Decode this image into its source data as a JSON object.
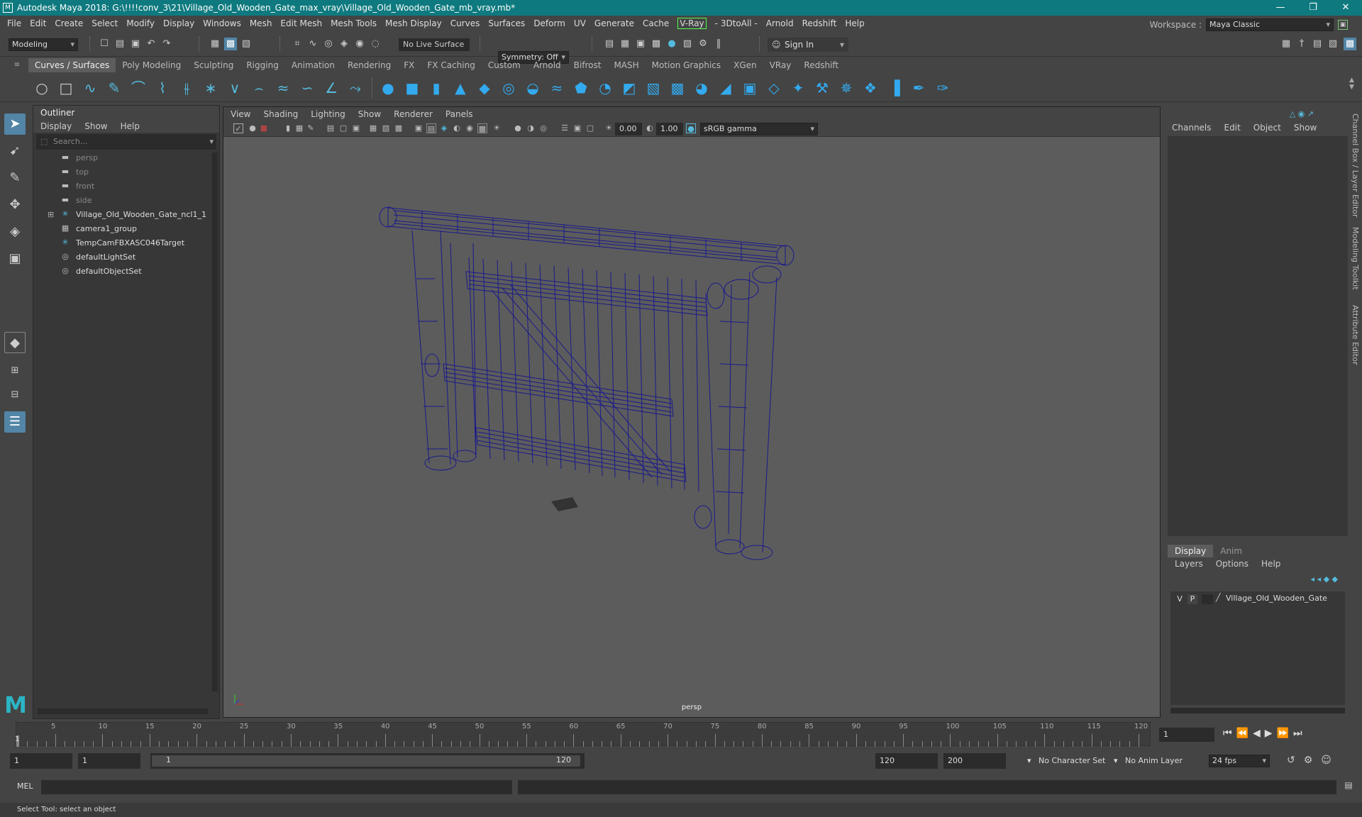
{
  "window": {
    "title": "Autodesk Maya 2018: G:\\!!!!conv_3\\21\\Village_Old_Wooden_Gate_max_vray\\Village_Old_Wooden_Gate_mb_vray.mb*",
    "min": "—",
    "max": "❐",
    "close": "✕"
  },
  "menubar": [
    "File",
    "Edit",
    "Create",
    "Select",
    "Modify",
    "Display",
    "Windows",
    "Mesh",
    "Edit Mesh",
    "Mesh Tools",
    "Mesh Display",
    "Curves",
    "Surfaces",
    "Deform",
    "UV",
    "Generate",
    "Cache",
    "V-Ray",
    "- 3DtoAll -",
    "Arnold",
    "Redshift",
    "Help"
  ],
  "workspace": {
    "label": "Workspace :",
    "value": "Maya Classic"
  },
  "status": {
    "mode": "Modeling",
    "live_surface": "No Live Surface",
    "symmetry": "Symmetry: Off",
    "sign_in": "Sign In"
  },
  "shelf_tabs": [
    "Curves / Surfaces",
    "Poly Modeling",
    "Sculpting",
    "Rigging",
    "Animation",
    "Rendering",
    "FX",
    "FX Caching",
    "Custom",
    "Arnold",
    "Bifrost",
    "MASH",
    "Motion Graphics",
    "XGen",
    "VRay",
    "Redshift"
  ],
  "outliner": {
    "title": "Outliner",
    "menu": [
      "Display",
      "Show",
      "Help"
    ],
    "search_placeholder": "Search...",
    "items": [
      {
        "label": "persp",
        "icon": "camera-icon",
        "dim": true
      },
      {
        "label": "top",
        "icon": "camera-icon",
        "dim": true
      },
      {
        "label": "front",
        "icon": "camera-icon",
        "dim": true
      },
      {
        "label": "side",
        "icon": "camera-icon",
        "dim": true
      },
      {
        "label": "Village_Old_Wooden_Gate_ncl1_1",
        "icon": "transform-icon",
        "expand": true
      },
      {
        "label": "camera1_group",
        "icon": "group-icon"
      },
      {
        "label": "TempCamFBXASC046Target",
        "icon": "transform-icon"
      },
      {
        "label": "defaultLightSet",
        "icon": "set-icon"
      },
      {
        "label": "defaultObjectSet",
        "icon": "set-icon"
      }
    ]
  },
  "viewport": {
    "menu": [
      "View",
      "Shading",
      "Lighting",
      "Show",
      "Renderer",
      "Panels"
    ],
    "exposure": "0.00",
    "gamma": "1.00",
    "color_space": "sRGB gamma",
    "camera": "persp"
  },
  "channel_box": {
    "menu": [
      "Channels",
      "Edit",
      "Object",
      "Show"
    ],
    "side_tabs": [
      "Channel Box / Layer Editor",
      "Modeling Toolkit",
      "Attribute Editor"
    ]
  },
  "layer_editor": {
    "tabs": [
      "Display",
      "Anim"
    ],
    "menu": [
      "Layers",
      "Options",
      "Help"
    ],
    "layer": {
      "v": "V",
      "p": "P",
      "name": "Village_Old_Wooden_Gate"
    }
  },
  "timeline": {
    "ticks": [
      "5",
      "10",
      "15",
      "20",
      "25",
      "30",
      "35",
      "40",
      "45",
      "50",
      "55",
      "60",
      "65",
      "70",
      "75",
      "80",
      "85",
      "90",
      "95",
      "100",
      "105",
      "110",
      "115",
      "120"
    ],
    "current_left": "1",
    "current_frame": "1"
  },
  "range": {
    "start": "1",
    "start2": "1",
    "slider_start": "1",
    "slider_end": "120",
    "end": "120",
    "end2": "200",
    "character_set": "No Character Set",
    "anim_layer": "No Anim Layer",
    "fps": "24 fps"
  },
  "command": {
    "label": "MEL"
  },
  "help_line": "Select Tool: select an object",
  "colors": {
    "title": "#0e7a7f",
    "wire": "#1a1a8c",
    "select": "#5285a6"
  }
}
